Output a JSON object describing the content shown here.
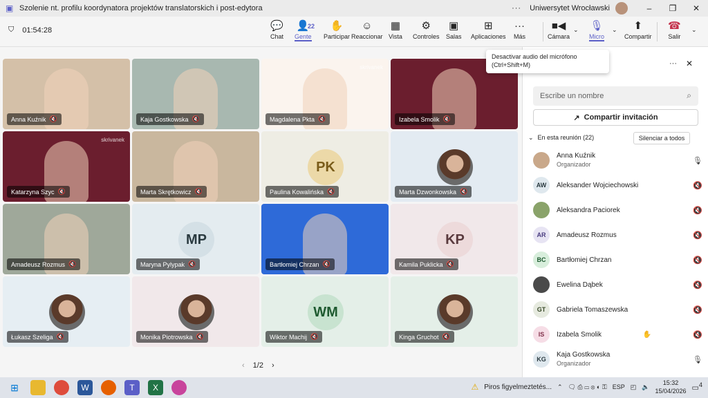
{
  "window": {
    "title": "Szolenie nt. profilu koordynatora projektów translatorskich i post-edytora",
    "org": "Uniwersytet Wrocławski",
    "dots": "···",
    "min": "–",
    "max": "❐",
    "close": "✕"
  },
  "call": {
    "timer": "01:54:28",
    "toolbar": [
      {
        "label": "Chat",
        "icon": "💬"
      },
      {
        "label": "Gente",
        "icon": "👤",
        "badge": "22",
        "active": true
      },
      {
        "label": "Participar",
        "icon": "✋"
      },
      {
        "label": "Reaccionar",
        "icon": "☺"
      },
      {
        "label": "Vista",
        "icon": "▦"
      },
      {
        "label": "Controles",
        "icon": "⚙"
      },
      {
        "label": "Salas",
        "icon": "▣"
      },
      {
        "label": "Aplicaciones",
        "icon": "⊞"
      },
      {
        "label": "Más",
        "icon": "···"
      }
    ],
    "camera": "Cámara",
    "mic": "Micro",
    "share": "Compartir",
    "leave": "Salir"
  },
  "tooltip": {
    "line1": "Desactivar audio del micrófono",
    "line2": "(Ctrl+Shift+M)"
  },
  "tiles": [
    {
      "name": "Anna Kuźnik",
      "kind": "video",
      "bg": "#d4c0a8"
    },
    {
      "name": "Kaja Gostkowska",
      "kind": "video",
      "bg": "#a8b8b0"
    },
    {
      "name": "Magdalena Pkta",
      "kind": "video",
      "bg": "#fbf4ee",
      "brand": "skrivanek"
    },
    {
      "name": "Izabela Smolik",
      "kind": "video",
      "bg": "#6b1e2e"
    },
    {
      "name": "Katarzyna Szyc",
      "kind": "video",
      "bg": "#6b1e2e",
      "brand": "skrivanek"
    },
    {
      "name": "Marta Skrętkowicz",
      "kind": "video",
      "bg": "#c9b79e"
    },
    {
      "name": "Paulina Kowalińska",
      "kind": "init",
      "init": "PK",
      "bg": "#eeede4",
      "ibg": "#ecd9a8",
      "ifg": "#7a5c1a"
    },
    {
      "name": "Marta Dzwonkowska",
      "kind": "pic",
      "bg": "#e3ebf2"
    },
    {
      "name": "Amadeusz Rozmus",
      "kind": "video",
      "bg": "#9fa89a"
    },
    {
      "name": "Maryna Pylypak",
      "kind": "init",
      "init": "MP",
      "bg": "#e4ecf0",
      "ibg": "#d4e0e6",
      "ifg": "#2a3a40"
    },
    {
      "name": "Bartłomiej Chrzan",
      "kind": "video",
      "bg": "#2e6ad8"
    },
    {
      "name": "Kamila Puklicka",
      "kind": "init",
      "init": "KP",
      "bg": "#f1e8ea",
      "ibg": "#eddadb",
      "ifg": "#5a3a3e"
    },
    {
      "name": "Łukasz Szeliga",
      "kind": "pic",
      "bg": "#e6eef3"
    },
    {
      "name": "Monika Piotrowska",
      "kind": "pic",
      "bg": "#f1e8ea"
    },
    {
      "name": "Wiktor Machij",
      "kind": "init",
      "init": "WM",
      "bg": "#e4efe8",
      "ibg": "#c8e3d0",
      "ifg": "#1e5a30"
    },
    {
      "name": "Kinga Gruchot",
      "kind": "pic",
      "bg": "#e4efe8"
    }
  ],
  "pager": {
    "prev": "‹",
    "text": "1/2",
    "next": "›"
  },
  "panel": {
    "more": "···",
    "close": "✕",
    "search_placeholder": "Escribe un nombre",
    "share_invite": "Compartir invitación",
    "section": "En esta reunión (22)",
    "mute_all": "Silenciar a todos",
    "people": [
      {
        "name": "Anna Kuźnik",
        "role": "Organizador",
        "av": "",
        "bg": "#c9a88a",
        "mic": "on"
      },
      {
        "name": "Aleksander Wojciechowski",
        "av": "AW",
        "bg": "#dfe8ee",
        "fg": "#2a3a40"
      },
      {
        "name": "Aleksandra Paciorek",
        "av": "",
        "bg": "#8aa36a"
      },
      {
        "name": "Amadeusz Rozmus",
        "av": "AR",
        "bg": "#e7e4f3",
        "fg": "#4a3d80"
      },
      {
        "name": "Bartłomiej Chrzan",
        "av": "BC",
        "bg": "#d8eedc",
        "fg": "#1e5a30"
      },
      {
        "name": "Ewelina Dąbek",
        "av": "",
        "bg": "#4a4a4a"
      },
      {
        "name": "Gabriela Tomaszewska",
        "av": "GT",
        "bg": "#e6eadf",
        "fg": "#3a4a2a"
      },
      {
        "name": "Izabela Smolik",
        "av": "IS",
        "bg": "#f6dde6",
        "fg": "#80304a",
        "hand": true
      },
      {
        "name": "Kaja Gostkowska",
        "role": "Organizador",
        "av": "KG",
        "bg": "#dfe8ee",
        "fg": "#2a3a40",
        "mic": "on"
      }
    ]
  },
  "taskbar": {
    "notif": "Piros figyelmeztetés...",
    "lang": "ESP",
    "time": "15:32",
    "date": "15/04/2026",
    "badge": "4"
  }
}
